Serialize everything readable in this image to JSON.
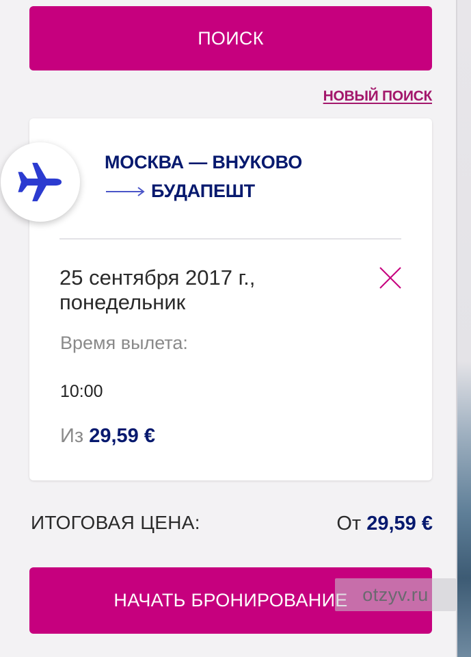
{
  "search_button": {
    "label": "ПОИСК"
  },
  "new_search_link": {
    "label": "НОВЫЙ ПОИСК"
  },
  "flight": {
    "icon": "airplane-icon",
    "origin": "МОСКВА — ВНУКОВО",
    "destination": "БУДАПЕШТ",
    "date_line1": "25 сентября 2017 г.,",
    "date_line2": "понедельник",
    "remove_icon": "close-icon",
    "departure_label": "Время вылета:",
    "departure_time": "10:00",
    "price_prefix": "Из",
    "price": "29,59 €"
  },
  "total": {
    "label": "ИТОГОВАЯ ЦЕНА:",
    "prefix": "От",
    "price": "29,59 €"
  },
  "book_button": {
    "label": "НАЧАТЬ БРОНИРОВАНИЕ"
  },
  "watermark": {
    "text": "otzyv.ru"
  },
  "colors": {
    "accent": "#c6007e",
    "link": "#a3176b",
    "navy": "#06196e",
    "plane": "#2b3bd0"
  }
}
